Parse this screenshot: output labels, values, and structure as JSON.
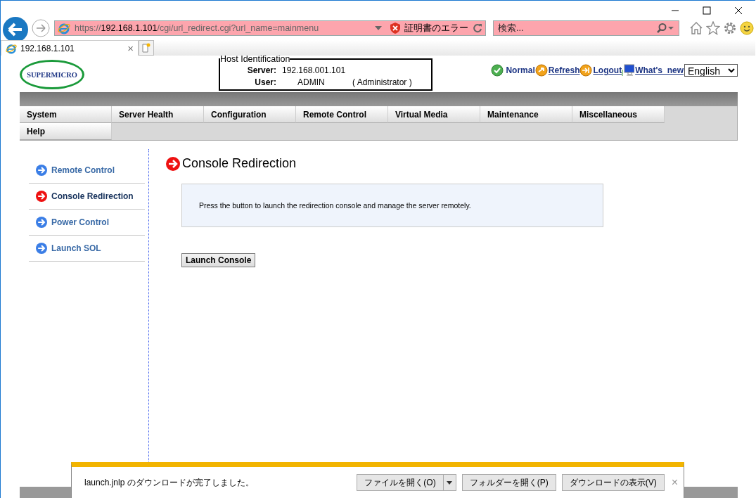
{
  "address_bar": {
    "url_scheme": "https://",
    "url_host": "192.168.1.101",
    "url_path": "/cgi/url_redirect.cgi?url_name=mainmenu",
    "certificate_error": "証明書のエラー"
  },
  "search": {
    "placeholder": "検索..."
  },
  "tabs": [
    {
      "label": "192.168.1.101",
      "selected": true,
      "close": "×"
    }
  ],
  "logo": "SUPERMICRO",
  "host_identification": {
    "legend": "Host Identification",
    "server_label": "Server:",
    "server_value": "192.168.001.101",
    "user_label": "User:",
    "user_value": "ADMIN",
    "user_role": "( Administrator )"
  },
  "status_links": [
    {
      "kind": "status",
      "label": "Normal"
    },
    {
      "kind": "refresh",
      "label": "Refresh"
    },
    {
      "kind": "logout",
      "label": "Logout"
    },
    {
      "kind": "news",
      "label": "What's  new"
    }
  ],
  "language": "English",
  "menu": [
    {
      "label": "System"
    },
    {
      "label": "Server Health"
    },
    {
      "label": "Configuration"
    },
    {
      "label": "Remote Control"
    },
    {
      "label": "Virtual Media"
    },
    {
      "label": "Maintenance"
    },
    {
      "label": "Miscellaneous"
    },
    {
      "label": "Help"
    }
  ],
  "sidebar": [
    {
      "label": "Remote Control",
      "selected": false
    },
    {
      "label": "Console Redirection",
      "selected": true
    },
    {
      "label": "Power Control",
      "selected": false
    },
    {
      "label": "Launch SOL",
      "selected": false
    }
  ],
  "content": {
    "title": "Console Redirection",
    "message": "Press the button to launch the redirection console and manage the server remotely.",
    "button": "Launch Console"
  },
  "download_bar": {
    "message": "launch.jnlp のダウンロードが完了しました。",
    "buttons": [
      {
        "kind": "split",
        "label": "ファイルを開く(O)"
      },
      {
        "kind": "plain",
        "label": "フォルダーを開く(P)"
      },
      {
        "kind": "plain",
        "label": "ダウンロードの表示(V)"
      }
    ],
    "close": "×"
  }
}
